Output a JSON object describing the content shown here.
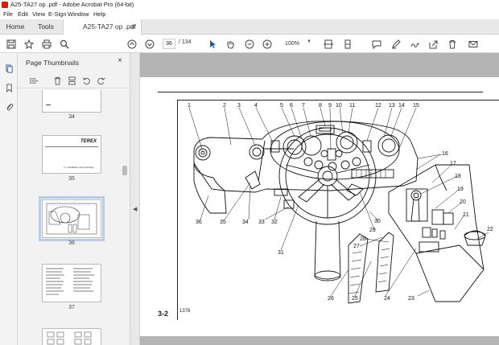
{
  "window": {
    "title": "A25-TA27 op .pdf - Adobe Acrobat Pro (64-bit)"
  },
  "menu": [
    "File",
    "Edit",
    "View",
    "E-Sign",
    "Window",
    "Help"
  ],
  "tabs": {
    "home": "Home",
    "tools": "Tools",
    "document": "A25-TA27 op .pdf",
    "close": "×"
  },
  "toolbar": {
    "page_current": "36",
    "page_total": "/ 134",
    "zoom": "100%"
  },
  "panel": {
    "title": "Page Thumbnails",
    "close": "×",
    "thumbnails": [
      {
        "label": "34"
      },
      {
        "label": "35",
        "brand": "TEREX",
        "caption": "4 - Installation and operating"
      },
      {
        "label": "36",
        "selected": true
      },
      {
        "label": "37"
      },
      {
        "label": ""
      }
    ]
  },
  "document": {
    "page_number": "3-2",
    "figure_code": "1376",
    "callouts": [
      "1",
      "2",
      "3",
      "4",
      "5",
      "6",
      "7",
      "8",
      "9",
      "10",
      "11",
      "12",
      "13",
      "14",
      "15",
      "16",
      "17",
      "18",
      "19",
      "20",
      "21",
      "22",
      "23",
      "24",
      "25",
      "26",
      "27",
      "28",
      "29",
      "30",
      "31",
      "32",
      "33",
      "34",
      "35",
      "36"
    ]
  },
  "icons": {
    "toolbar": [
      "save-icon",
      "bookmark-star-icon",
      "print-icon",
      "search-icon",
      "prev-page-icon",
      "next-page-icon",
      "select-cursor-icon",
      "hand-icon",
      "zoom-out-icon",
      "zoom-in-icon",
      "fit-page-icon",
      "scroll-mode-icon",
      "comment-icon",
      "highlight-pen-icon",
      "sign-icon",
      "share-icon",
      "delete-icon",
      "email-icon"
    ],
    "rail": [
      "page-thumbnails-icon",
      "bookmarks-icon",
      "attachments-icon"
    ],
    "panel": [
      "options-menu-icon",
      "delete-icon",
      "extract-pages-icon",
      "undo-icon",
      "redo-icon"
    ]
  }
}
